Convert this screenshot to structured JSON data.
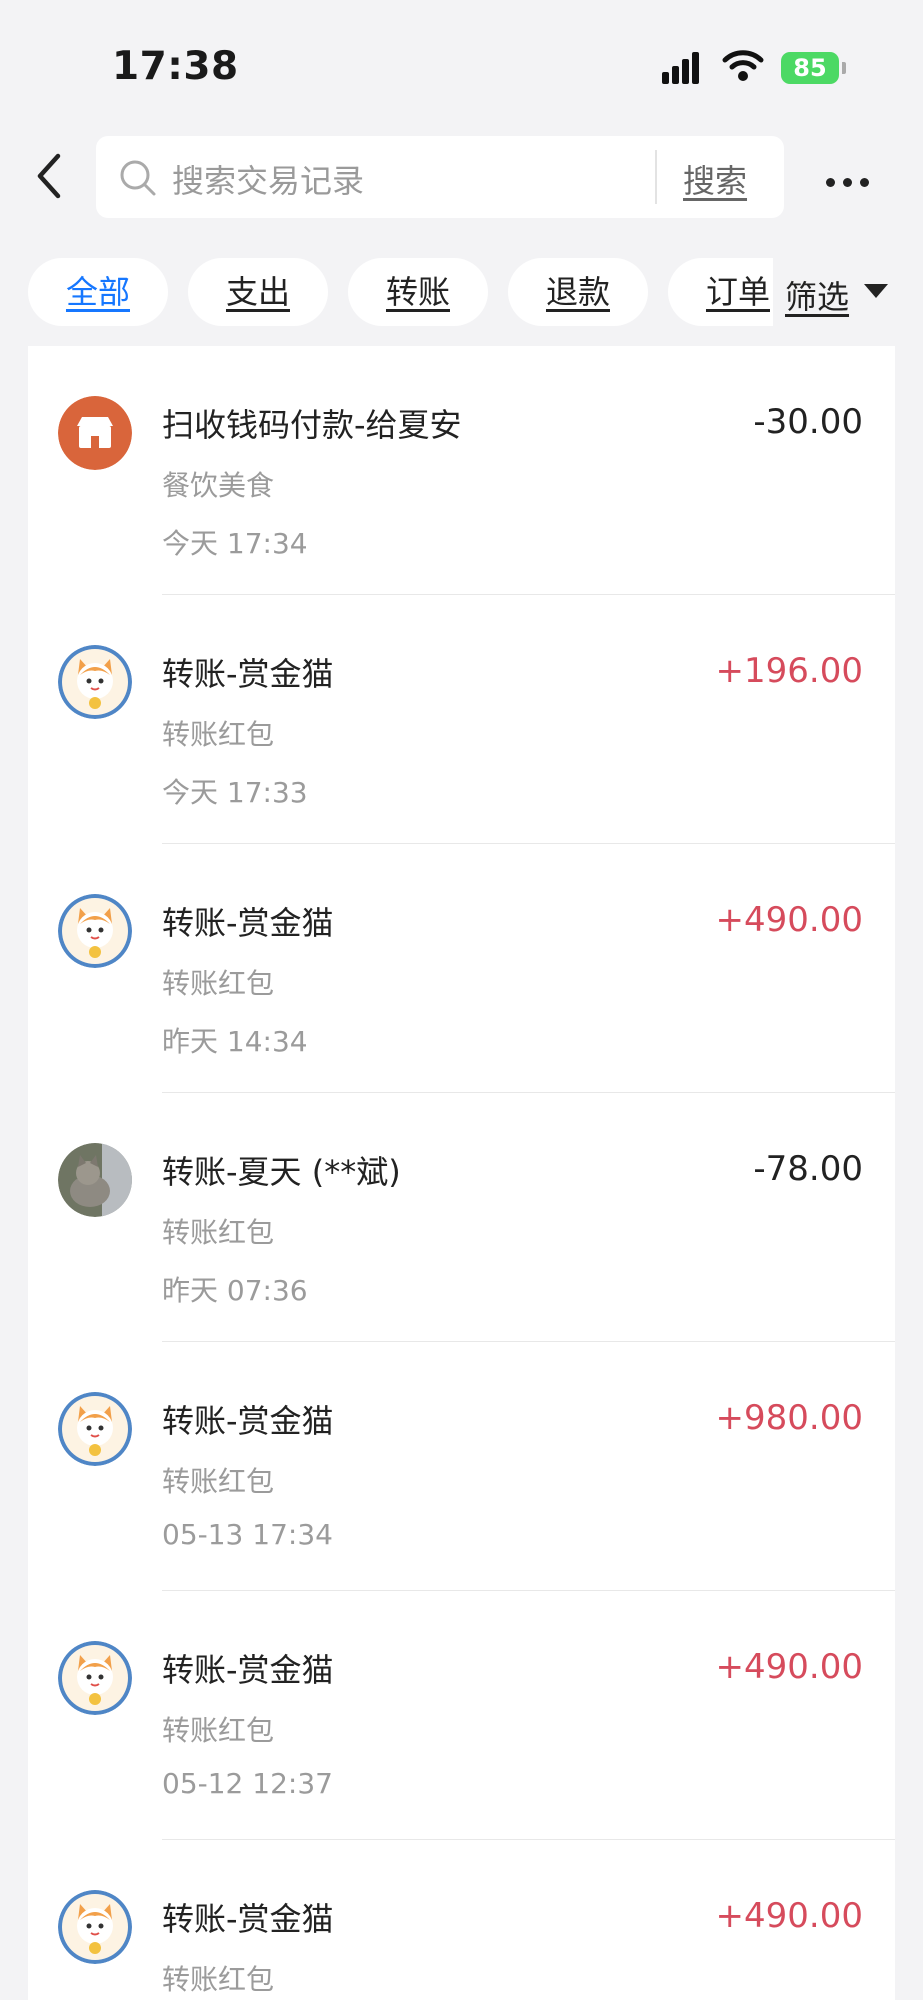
{
  "status_bar": {
    "time": "17:38",
    "battery": "85"
  },
  "search": {
    "placeholder": "搜索交易记录",
    "button": "搜索"
  },
  "tabs": [
    "全部",
    "支出",
    "转账",
    "退款",
    "订单"
  ],
  "filter": {
    "label": "筛选"
  },
  "transactions": [
    {
      "title": "扫收钱码付款-给夏安",
      "category": "餐饮美食",
      "time": "今天 17:34",
      "amount": "-30.00",
      "direction": "expense",
      "avatar": "store-icon"
    },
    {
      "title": "转账-赏金猫",
      "category": "转账红包",
      "time": "今天 17:33",
      "amount": "+196.00",
      "direction": "income",
      "avatar": "lucky-cat-avatar"
    },
    {
      "title": "转账-赏金猫",
      "category": "转账红包",
      "time": "昨天 14:34",
      "amount": "+490.00",
      "direction": "income",
      "avatar": "lucky-cat-avatar"
    },
    {
      "title": "转账-夏天 (**斌)",
      "category": "转账红包",
      "time": "昨天 07:36",
      "amount": "-78.00",
      "direction": "expense",
      "avatar": "cat-photo-avatar"
    },
    {
      "title": "转账-赏金猫",
      "category": "转账红包",
      "time": "05-13 17:34",
      "amount": "+980.00",
      "direction": "income",
      "avatar": "lucky-cat-avatar"
    },
    {
      "title": "转账-赏金猫",
      "category": "转账红包",
      "time": "05-12 12:37",
      "amount": "+490.00",
      "direction": "income",
      "avatar": "lucky-cat-avatar"
    },
    {
      "title": "转账-赏金猫",
      "category": "转账红包",
      "time": "",
      "amount": "+490.00",
      "direction": "income",
      "avatar": "lucky-cat-avatar"
    }
  ],
  "colors": {
    "income": "#d64b5c",
    "expense": "#222222",
    "active_tab": "#1677ff",
    "store_icon": "#d9653b"
  }
}
